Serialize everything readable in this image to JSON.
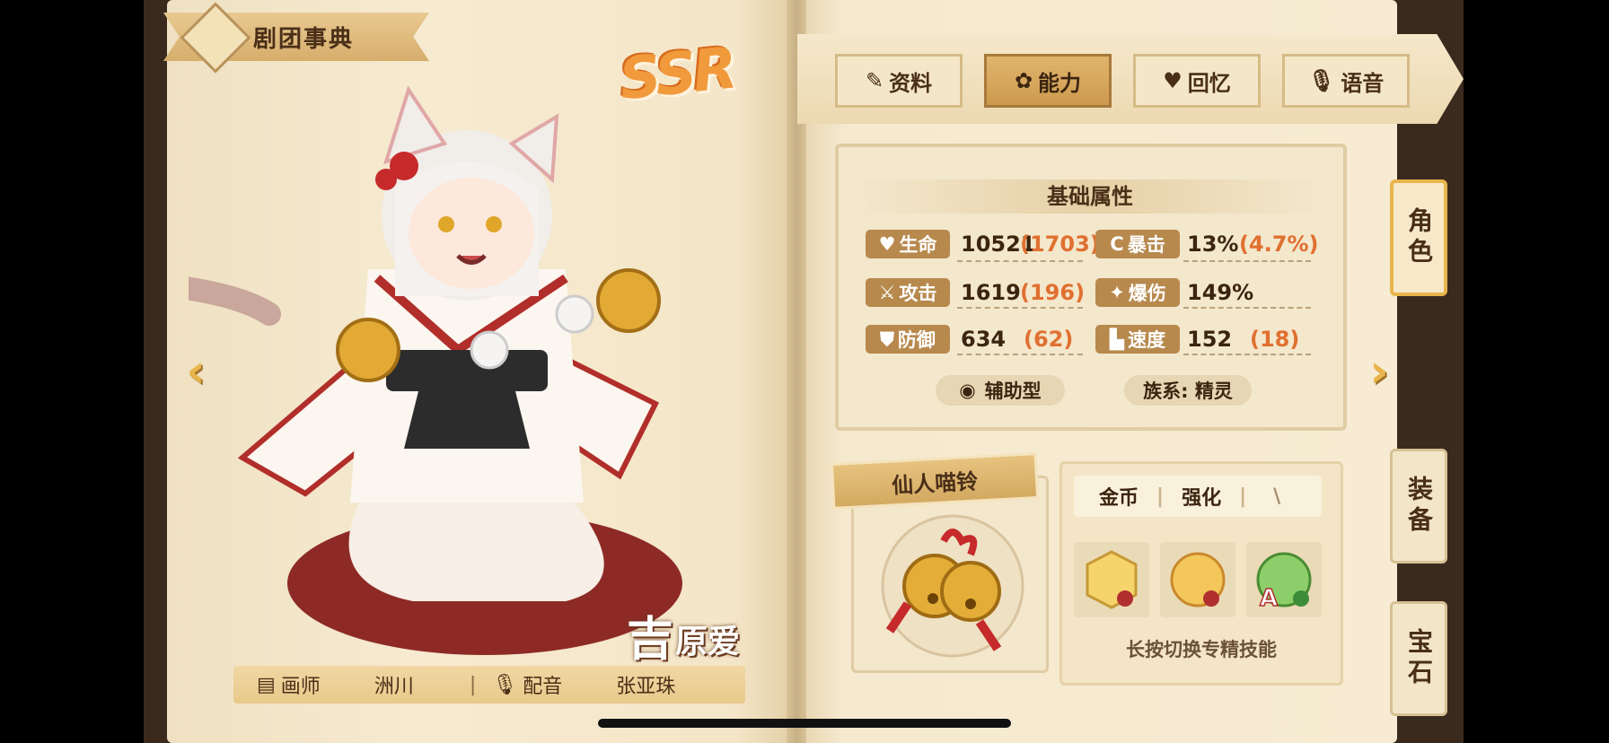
{
  "header": {
    "title": "剧团事典"
  },
  "rarity": "SSR",
  "character": {
    "name_big": "吉",
    "name_rest": "原爱"
  },
  "credits": {
    "artist_label": "画师",
    "artist": "洲川",
    "voice_label": "配音",
    "voice": "张亚珠"
  },
  "tabs": [
    {
      "label": "资料",
      "icon": "notebook-icon",
      "active": false
    },
    {
      "label": "能力",
      "icon": "paw-icon",
      "active": true
    },
    {
      "label": "回忆",
      "icon": "heart-icon",
      "active": false
    },
    {
      "label": "语音",
      "icon": "microphone-icon",
      "active": false
    }
  ],
  "stats": {
    "header": "基础属性",
    "rows": [
      {
        "left": {
          "label": "生命",
          "icon": "heart-icon",
          "value": "10521",
          "bonus": "(1703)"
        },
        "right": {
          "label": "暴击",
          "icon": "crit-icon",
          "value": "13%",
          "bonus": "(4.7%)"
        }
      },
      {
        "left": {
          "label": "攻击",
          "icon": "sword-icon",
          "value": "1619",
          "bonus": "(196)"
        },
        "right": {
          "label": "爆伤",
          "icon": "burst-icon",
          "value": "149%",
          "bonus": ""
        }
      },
      {
        "left": {
          "label": "防御",
          "icon": "shield-icon",
          "value": "634",
          "bonus": "(62)"
        },
        "right": {
          "label": "速度",
          "icon": "boot-icon",
          "value": "152",
          "bonus": "(18)"
        }
      }
    ],
    "role_tag": "辅助型",
    "race_tag": "族系: 精灵"
  },
  "exclusive_item": {
    "name": "仙人喵铃"
  },
  "skills": {
    "tabs": [
      "金币",
      "强化",
      "\\"
    ],
    "hint": "长按切换专精技能",
    "icons": [
      "skill-icon-1",
      "skill-icon-2",
      "skill-icon-3"
    ]
  },
  "side_tabs": [
    {
      "label": "角色",
      "active": true
    },
    {
      "label": "装备",
      "active": false
    },
    {
      "label": "宝石",
      "active": false
    }
  ],
  "colors": {
    "accent": "#cc9a4e",
    "bonus": "#e07030",
    "chip": "#b7894d"
  }
}
